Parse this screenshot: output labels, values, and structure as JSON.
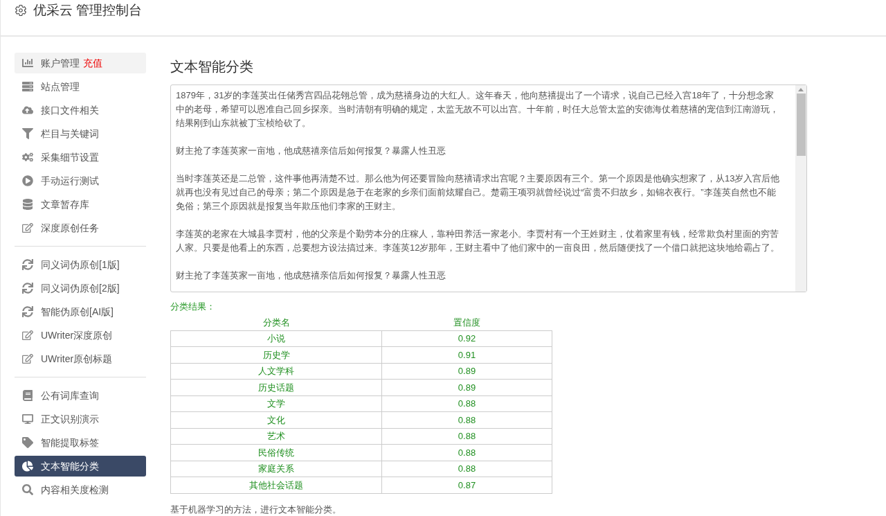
{
  "header": {
    "title": "优采云 管理控制台"
  },
  "sidebar": {
    "groups": [
      {
        "items": [
          {
            "label": "账户管理",
            "badge": "充值",
            "selected": false,
            "hovered": true
          },
          {
            "label": "站点管理",
            "selected": false,
            "hovered": false
          },
          {
            "label": "接口文件相关",
            "selected": false,
            "hovered": false
          },
          {
            "label": "栏目与关键词",
            "selected": false,
            "hovered": false
          },
          {
            "label": "采集细节设置",
            "selected": false,
            "hovered": false
          },
          {
            "label": "手动运行测试",
            "selected": false,
            "hovered": false
          },
          {
            "label": "文章暂存库",
            "selected": false,
            "hovered": false
          },
          {
            "label": "深度原创任务",
            "selected": false,
            "hovered": false
          }
        ]
      },
      {
        "items": [
          {
            "label": "同义词伪原创[1版]",
            "selected": false,
            "hovered": false
          },
          {
            "label": "同义词伪原创[2版]",
            "selected": false,
            "hovered": false
          },
          {
            "label": "智能伪原创[AI版]",
            "selected": false,
            "hovered": false
          },
          {
            "label": "UWriter深度原创",
            "selected": false,
            "hovered": false
          },
          {
            "label": "UWriter原创标题",
            "selected": false,
            "hovered": false
          }
        ]
      },
      {
        "items": [
          {
            "label": "公有词库查询",
            "selected": false,
            "hovered": false
          },
          {
            "label": "正文识别演示",
            "selected": false,
            "hovered": false
          },
          {
            "label": "智能提取标签",
            "selected": false,
            "hovered": false
          },
          {
            "label": "文本智能分类",
            "selected": true,
            "hovered": false
          },
          {
            "label": "内容相关度检测",
            "selected": false,
            "hovered": false
          }
        ]
      }
    ]
  },
  "main": {
    "title": "文本智能分类",
    "input": {
      "paragraphs": [
        "1879年，31岁的李莲英出任储秀宫四品花翎总管，成为慈禧身边的大红人。这年春天，他向慈禧提出了一个请求，说自己已经入宫18年了，十分想念家中的老母，希望可以恩准自己回乡探亲。当时清朝有明确的规定，太监无故不可以出宫。十年前，时任大总管太监的安德海仗着慈禧的宠信到江南游玩，结果刚到山东就被丁宝桢给砍了。",
        "财主抢了李莲英家一亩地，他成慈禧亲信后如何报复？暴露人性丑恶",
        "当时李莲英还是二总管，这件事他再清楚不过。那么他为何还要冒险向慈禧请求出宫呢？主要原因有三个。第一个原因是他确实想家了，从13岁入宫后他就再也没有见过自己的母亲；第二个原因是急于在老家的乡亲们面前炫耀自己。楚霸王项羽就曾经说过“富贵不归故乡，如锦衣夜行。”李莲英自然也不能免俗；第三个原因就是报复当年欺压他们李家的王财主。",
        "李莲英的老家在大城县李贾村，他的父亲是个勤劳本分的庄稼人，靠种田养活一家老小。李贾村有一个王姓财主，仗着家里有钱，经常欺负村里面的穷苦人家。只要是他看上的东西，总要想方设法搞过来。李莲英12岁那年，王财主看中了他们家中的一亩良田，然后随便找了一个借口就把这块地给霸占了。",
        "财主抢了李莲英家一亩地，他成慈禧亲信后如何报复？暴露人性丑恶"
      ]
    },
    "result_label": "分类结果：",
    "table": {
      "columns": [
        "分类名",
        "置信度"
      ],
      "rows": [
        [
          "小说",
          "0.92"
        ],
        [
          "历史学",
          "0.91"
        ],
        [
          "人文学科",
          "0.89"
        ],
        [
          "历史话题",
          "0.89"
        ],
        [
          "文学",
          "0.88"
        ],
        [
          "文化",
          "0.88"
        ],
        [
          "艺术",
          "0.88"
        ],
        [
          "民俗传统",
          "0.88"
        ],
        [
          "家庭关系",
          "0.88"
        ],
        [
          "其他社会话题",
          "0.87"
        ]
      ]
    },
    "footer_note": "基于机器学习的方法，进行文本智能分类。"
  }
}
